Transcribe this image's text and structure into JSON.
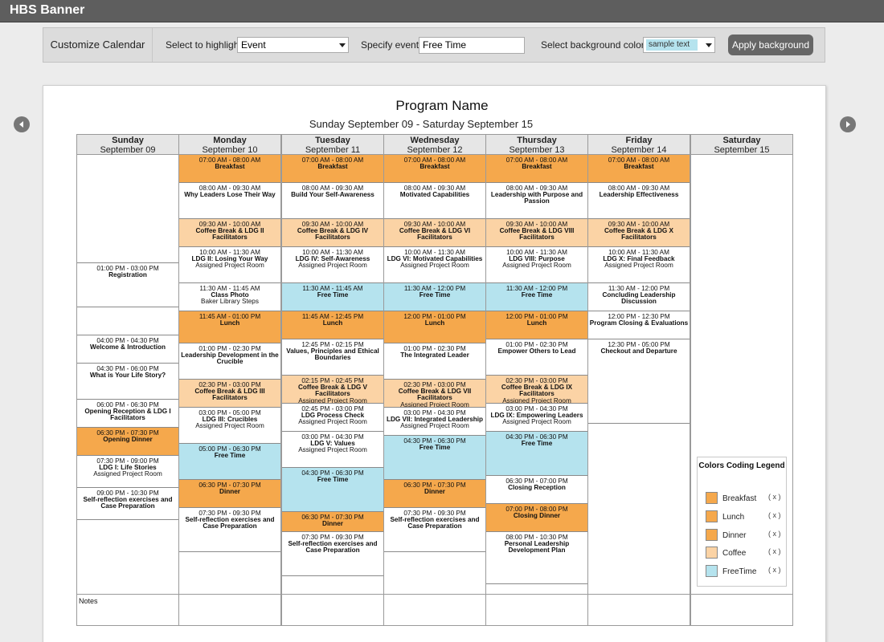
{
  "banner": {
    "title": "HBS Banner"
  },
  "toolbar": {
    "title": "Customize Calendar",
    "highlight_label": "Select to highlight",
    "highlight_value": "Event",
    "event_label": "Specify event",
    "event_value": "Free Time",
    "bg_label": "Select background color",
    "bg_sample": "sample text",
    "apply_label": "Apply background"
  },
  "colors": {
    "breakfast": "#f5a84c",
    "lunch": "#f5a84c",
    "dinner": "#f5a84c",
    "coffee": "#fbd3a5",
    "freetime": "#b5e3ee",
    "empty": "#ffffff"
  },
  "calendar": {
    "program_name": "Program Name",
    "date_range": "Sunday September 09 - Saturday September 15",
    "notes_label": "Notes",
    "days": [
      {
        "day": "Sunday",
        "date": "September 09",
        "events": [
          {
            "type": "empty",
            "time": "",
            "name": "",
            "room": ""
          },
          {
            "type": "normal",
            "time": "01:00 PM - 03:00 PM",
            "name": "Registration",
            "room": ""
          },
          {
            "type": "empty",
            "time": "",
            "name": "",
            "room": ""
          },
          {
            "type": "normal",
            "time": "04:00 PM - 04:30 PM",
            "name": "Welcome & Introduction",
            "room": ""
          },
          {
            "type": "normal",
            "time": "04:30 PM - 06:00 PM",
            "name": "What is Your Life Story?",
            "room": ""
          },
          {
            "type": "normal",
            "time": "06:00 PM - 06:30 PM",
            "name": "Opening Reception & LDG I Facilitators",
            "room": ""
          },
          {
            "type": "dinner",
            "time": "06:30 PM - 07:30 PM",
            "name": "Opening Dinner",
            "room": ""
          },
          {
            "type": "normal",
            "time": "07:30 PM - 09:00 PM",
            "name": "LDG I: Life Stories",
            "room": "Assigned Project Room"
          },
          {
            "type": "normal",
            "time": "09:00 PM - 10:30 PM",
            "name": "Self-reflection exercises and Case Preparation",
            "room": ""
          }
        ]
      },
      {
        "day": "Monday",
        "date": "September 10",
        "events": [
          {
            "type": "breakfast",
            "time": "07:00 AM - 08:00 AM",
            "name": "Breakfast",
            "room": ""
          },
          {
            "type": "normal",
            "time": "08:00 AM - 09:30 AM",
            "name": "Why Leaders Lose Their Way",
            "room": ""
          },
          {
            "type": "coffee",
            "time": "09:30 AM - 10:00 AM",
            "name": "Coffee Break & LDG II Facilitators",
            "room": ""
          },
          {
            "type": "normal",
            "time": "10:00 AM - 11:30 AM",
            "name": "LDG II: Losing Your Way",
            "room": "Assigned Project Room"
          },
          {
            "type": "normal",
            "time": "11:30 AM - 11:45 AM",
            "name": "Class Photo",
            "room": "Baker Library Steps"
          },
          {
            "type": "lunch",
            "time": "11:45 AM - 01:00 PM",
            "name": "Lunch",
            "room": ""
          },
          {
            "type": "normal",
            "time": "01:00 PM - 02:30 PM",
            "name": "Leadership Development in the Crucible",
            "room": ""
          },
          {
            "type": "coffee",
            "time": "02:30 PM - 03:00 PM",
            "name": "Coffee Break & LDG III Facilitators",
            "room": ""
          },
          {
            "type": "normal",
            "time": "03:00 PM - 05:00 PM",
            "name": "LDG III: Crucibles",
            "room": "Assigned Project Room"
          },
          {
            "type": "freetime",
            "time": "05:00 PM - 06:30 PM",
            "name": "Free Time",
            "room": ""
          },
          {
            "type": "dinner",
            "time": "06:30 PM - 07:30 PM",
            "name": "Dinner",
            "room": ""
          },
          {
            "type": "normal",
            "time": "07:30 PM - 09:30 PM",
            "name": "Self-reflection exercises and Case Preparation",
            "room": ""
          }
        ]
      },
      {
        "day": "Tuesday",
        "date": "September 11",
        "events": [
          {
            "type": "breakfast",
            "time": "07:00 AM - 08:00 AM",
            "name": "Breakfast",
            "room": ""
          },
          {
            "type": "normal",
            "time": "08:00 AM - 09:30 AM",
            "name": "Build Your Self-Awareness",
            "room": ""
          },
          {
            "type": "coffee",
            "time": "09:30 AM - 10:00 AM",
            "name": "Coffee Break & LDG IV Facilitators",
            "room": ""
          },
          {
            "type": "normal",
            "time": "10:00 AM - 11:30 AM",
            "name": "LDG IV: Self-Awareness",
            "room": "Assigned Project Room"
          },
          {
            "type": "freetime",
            "time": "11:30 AM - 11:45 AM",
            "name": "Free Time",
            "room": ""
          },
          {
            "type": "lunch",
            "time": "11:45 AM - 12:45 PM",
            "name": "Lunch",
            "room": ""
          },
          {
            "type": "normal",
            "time": "12:45 PM - 02:15 PM",
            "name": "Values, Principles and Ethical Boundaries",
            "room": ""
          },
          {
            "type": "coffee",
            "time": "02:15 PM - 02:45 PM",
            "name": "Coffee Break & LDG V Facilitators",
            "room": "Assigned Project Room"
          },
          {
            "type": "normal",
            "time": "02:45 PM - 03:00 PM",
            "name": "LDG Process Check",
            "room": "Assigned Project Room"
          },
          {
            "type": "normal",
            "time": "03:00 PM - 04:30 PM",
            "name": "LDG V: Values",
            "room": "Assigned Project Room"
          },
          {
            "type": "freetime",
            "time": "04:30 PM - 06:30 PM",
            "name": "Free Time",
            "room": ""
          },
          {
            "type": "dinner",
            "time": "06:30 PM - 07:30 PM",
            "name": "Dinner",
            "room": ""
          },
          {
            "type": "normal",
            "time": "07:30 PM - 09:30 PM",
            "name": "Self-reflection exercises and Case Preparation",
            "room": ""
          }
        ]
      },
      {
        "day": "Wednesday",
        "date": "September 12",
        "events": [
          {
            "type": "breakfast",
            "time": "07:00 AM - 08:00 AM",
            "name": "Breakfast",
            "room": ""
          },
          {
            "type": "normal",
            "time": "08:00 AM - 09:30 AM",
            "name": "Motivated Capabilities",
            "room": ""
          },
          {
            "type": "coffee",
            "time": "09:30 AM - 10:00 AM",
            "name": "Coffee Break & LDG VI Facilitators",
            "room": ""
          },
          {
            "type": "normal",
            "time": "10:00 AM - 11:30 AM",
            "name": "LDG VI: Motivated Capabilities",
            "room": "Assigned Project Room"
          },
          {
            "type": "freetime",
            "time": "11:30 AM - 12:00 PM",
            "name": "Free Time",
            "room": ""
          },
          {
            "type": "lunch",
            "time": "12:00 PM - 01:00 PM",
            "name": "Lunch",
            "room": ""
          },
          {
            "type": "normal",
            "time": "01:00 PM - 02:30 PM",
            "name": "The Integrated Leader",
            "room": ""
          },
          {
            "type": "coffee",
            "time": "02:30 PM - 03:00 PM",
            "name": "Coffee Break & LDG VII Facilitators",
            "room": "Assigned Project Room"
          },
          {
            "type": "normal",
            "time": "03:00 PM - 04:30 PM",
            "name": "LDG VII: Integrated Leadership",
            "room": "Assigned Project Room"
          },
          {
            "type": "freetime",
            "time": "04:30 PM - 06:30 PM",
            "name": "Free Time",
            "room": ""
          },
          {
            "type": "dinner",
            "time": "06:30 PM - 07:30 PM",
            "name": "Dinner",
            "room": ""
          },
          {
            "type": "normal",
            "time": "07:30 PM - 09:30 PM",
            "name": "Self-reflection exercises and Case Preparation",
            "room": ""
          }
        ]
      },
      {
        "day": "Thursday",
        "date": "September 13",
        "events": [
          {
            "type": "breakfast",
            "time": "07:00 AM - 08:00 AM",
            "name": "Breakfast",
            "room": ""
          },
          {
            "type": "normal",
            "time": "08:00 AM - 09:30 AM",
            "name": "Leadership with Purpose and Passion",
            "room": ""
          },
          {
            "type": "coffee",
            "time": "09:30 AM - 10:00 AM",
            "name": "Coffee Break & LDG VIII Facilitators",
            "room": ""
          },
          {
            "type": "normal",
            "time": "10:00 AM - 11:30 AM",
            "name": "LDG VIII: Purpose",
            "room": "Assigned Project Room"
          },
          {
            "type": "freetime",
            "time": "11:30 AM - 12:00 PM",
            "name": "Free Time",
            "room": ""
          },
          {
            "type": "lunch",
            "time": "12:00 PM - 01:00 PM",
            "name": "Lunch",
            "room": ""
          },
          {
            "type": "normal",
            "time": "01:00 PM - 02:30 PM",
            "name": "Empower Others to Lead",
            "room": ""
          },
          {
            "type": "coffee",
            "time": "02:30 PM - 03:00 PM",
            "name": "Coffee Break & LDG IX Facilitators",
            "room": "Assigned Project Room"
          },
          {
            "type": "normal",
            "time": "03:00 PM - 04:30 PM",
            "name": "LDG IX: Empowering Leaders",
            "room": "Assigned Project Room"
          },
          {
            "type": "freetime",
            "time": "04:30 PM - 06:30 PM",
            "name": "Free Time",
            "room": ""
          },
          {
            "type": "normal",
            "time": "06:30 PM - 07:00 PM",
            "name": "Closing Reception",
            "room": ""
          },
          {
            "type": "dinner",
            "time": "07:00 PM - 08:00 PM",
            "name": "Closing Dinner",
            "room": ""
          },
          {
            "type": "normal",
            "time": "08:00 PM - 10:30 PM",
            "name": "Personal Leadership Development Plan",
            "room": ""
          }
        ]
      },
      {
        "day": "Friday",
        "date": "September 14",
        "events": [
          {
            "type": "breakfast",
            "time": "07:00 AM - 08:00 AM",
            "name": "Breakfast",
            "room": ""
          },
          {
            "type": "normal",
            "time": "08:00 AM - 09:30 AM",
            "name": "Leadership Effectiveness",
            "room": ""
          },
          {
            "type": "coffee",
            "time": "09:30 AM - 10:00 AM",
            "name": "Coffee Break & LDG X Facilitators",
            "room": ""
          },
          {
            "type": "normal",
            "time": "10:00 AM - 11:30 AM",
            "name": "LDG X: Final Feedback",
            "room": "Assigned Project Room"
          },
          {
            "type": "normal",
            "time": "11:30 AM - 12:00 PM",
            "name": "Concluding Leadership Discussion",
            "room": ""
          },
          {
            "type": "normal",
            "time": "12:00 PM - 12:30 PM",
            "name": "Program Closing & Evaluations",
            "room": ""
          },
          {
            "type": "normal",
            "time": "12:30 PM - 05:00 PM",
            "name": "Checkout and Departure",
            "room": ""
          }
        ]
      },
      {
        "day": "Saturday",
        "date": "September 15",
        "events": []
      }
    ]
  },
  "legend": {
    "title": "Colors Coding Legend",
    "items": [
      {
        "label": "Breakfast",
        "color": "#f5a84c",
        "remove": "( x )"
      },
      {
        "label": "Lunch",
        "color": "#f5a84c",
        "remove": "( x )"
      },
      {
        "label": "Dinner",
        "color": "#f5a84c",
        "remove": "( x )"
      },
      {
        "label": "Coffee",
        "color": "#fbd3a5",
        "remove": "( x )"
      },
      {
        "label": "FreeTime",
        "color": "#b5e3ee",
        "remove": "( x )"
      }
    ]
  }
}
